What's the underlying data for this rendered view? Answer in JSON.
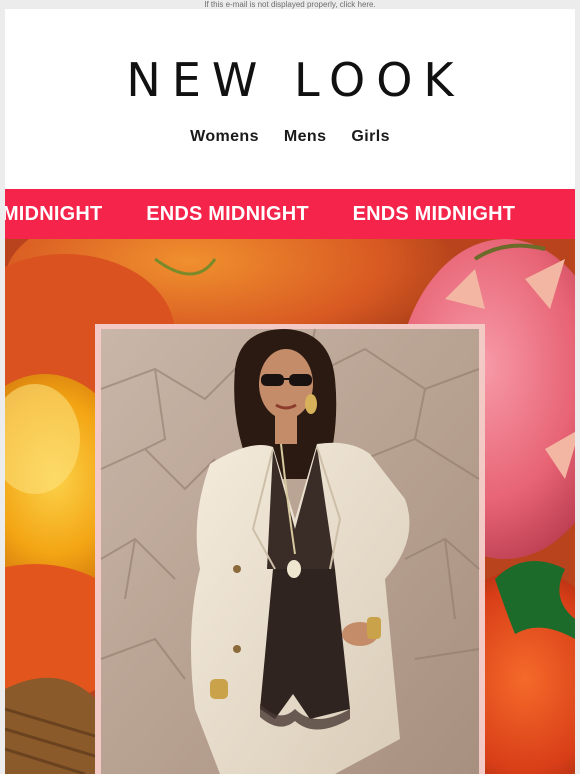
{
  "preheader": {
    "text": "If this e-mail is not displayed properly, click here."
  },
  "header": {
    "logo_text": "NEW LOOK"
  },
  "nav": {
    "items": [
      {
        "label": "Womens"
      },
      {
        "label": "Mens"
      },
      {
        "label": "Girls"
      }
    ]
  },
  "banner": {
    "ticker_items": [
      "DS MIDNIGHT",
      "ENDS MIDNIGHT",
      "ENDS MIDNIGHT"
    ],
    "background_color": "#f4244a",
    "text_color": "#ffffff"
  },
  "hero": {
    "image_description_icon": "fashion-photo",
    "frame_color": "#f2c9c4"
  }
}
